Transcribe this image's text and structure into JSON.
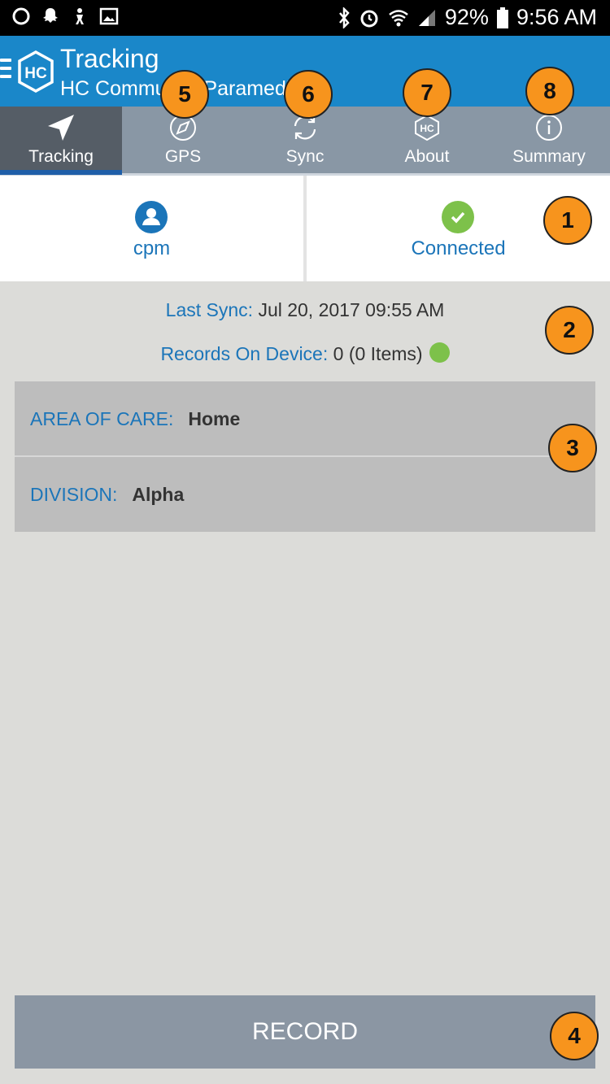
{
  "status_bar": {
    "battery": "92%",
    "time": "9:56 AM"
  },
  "app": {
    "title": "Tracking",
    "subtitle": "HC Community Paramedic",
    "logo_text": "HC"
  },
  "tabs": [
    {
      "label": "Tracking",
      "icon": "navigation-arrow-icon",
      "active": true
    },
    {
      "label": "GPS",
      "icon": "compass-icon",
      "active": false
    },
    {
      "label": "Sync",
      "icon": "sync-icon",
      "active": false
    },
    {
      "label": "About",
      "icon": "hc-shield-icon",
      "active": false
    },
    {
      "label": "Summary",
      "icon": "info-icon",
      "active": false
    }
  ],
  "status": {
    "user": "cpm",
    "connection": "Connected"
  },
  "sync": {
    "last_sync_label": "Last Sync:",
    "last_sync_value": "Jul 20, 2017 09:55 AM",
    "records_label": "Records On Device:",
    "records_value": "0 (0 Items)"
  },
  "fields": {
    "area_of_care_label": "AREA OF CARE:",
    "area_of_care_value": "Home",
    "division_label": "DIVISION:",
    "division_value": "Alpha"
  },
  "record_button": "RECORD",
  "callouts": [
    "1",
    "2",
    "3",
    "4",
    "5",
    "6",
    "7",
    "8"
  ],
  "colors": {
    "header_blue": "#1a87c9",
    "tab_gray": "#8997a5",
    "tab_active": "#555d66",
    "accent_blue": "#1b75b9",
    "connected_green": "#7dc14a",
    "callout_orange": "#f7941d"
  }
}
